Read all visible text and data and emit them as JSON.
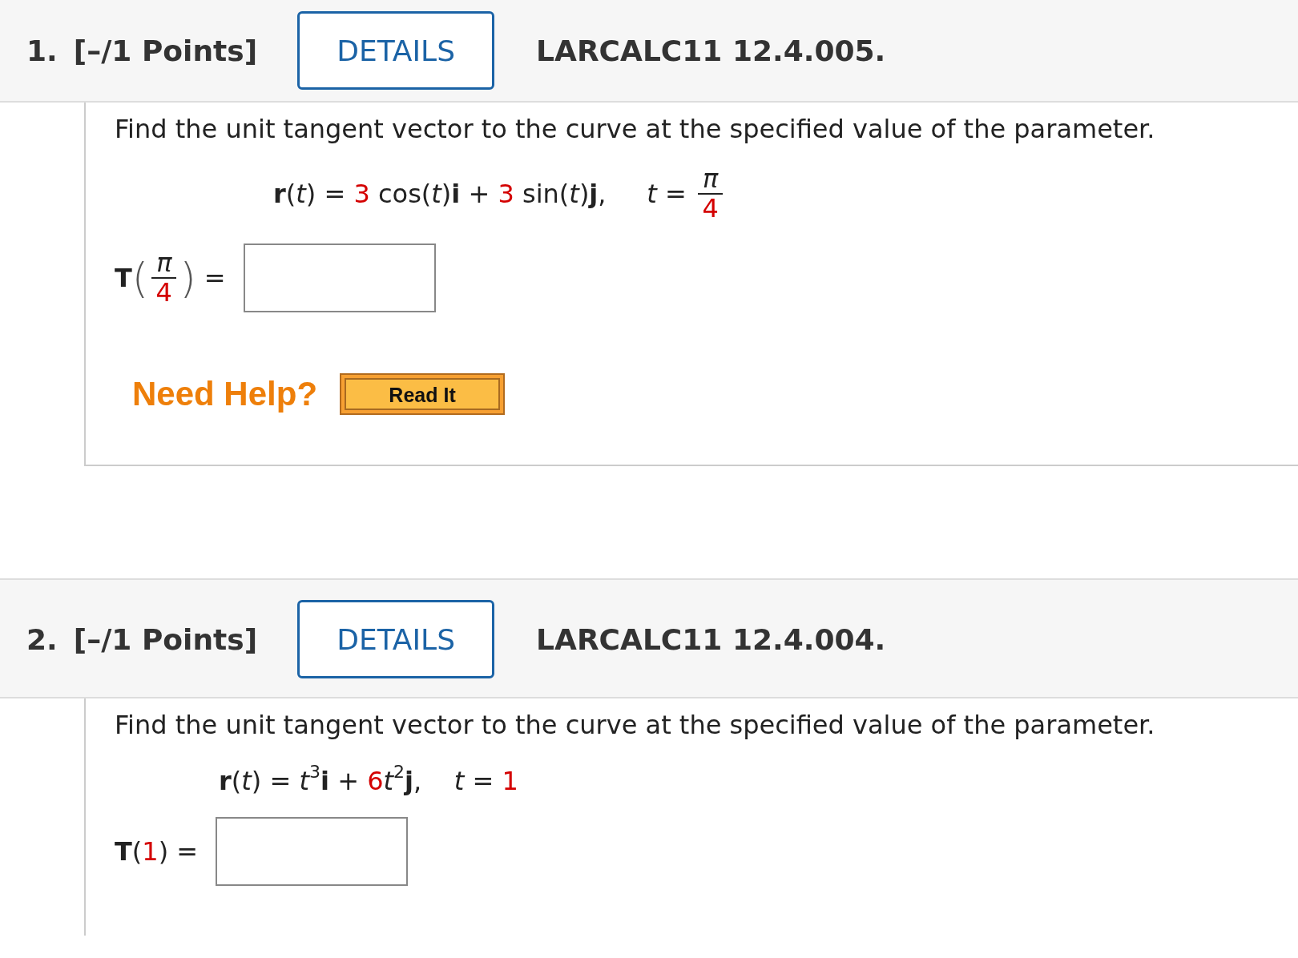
{
  "questions": [
    {
      "number": "1.",
      "points": "[–/1 Points]",
      "details_button": "DETAILS",
      "problem_id": "LARCALC11 12.4.005.",
      "prompt": "Find the unit tangent vector to the curve at the specified value of the parameter.",
      "formula": [
        {
          "kind": "bold",
          "text": "r"
        },
        {
          "kind": "plain",
          "text": "("
        },
        {
          "kind": "italic",
          "text": "t"
        },
        {
          "kind": "plain",
          "text": ") = "
        },
        {
          "kind": "red",
          "text": "3"
        },
        {
          "kind": "plain",
          "text": " cos("
        },
        {
          "kind": "italic",
          "text": "t"
        },
        {
          "kind": "plain",
          "text": ")"
        },
        {
          "kind": "bold",
          "text": "i"
        },
        {
          "kind": "plain",
          "text": " + "
        },
        {
          "kind": "red",
          "text": "3"
        },
        {
          "kind": "plain",
          "text": " sin("
        },
        {
          "kind": "italic",
          "text": "t"
        },
        {
          "kind": "plain",
          "text": ")"
        },
        {
          "kind": "bold",
          "text": "j"
        },
        {
          "kind": "plain",
          "text": ",     "
        },
        {
          "kind": "italic",
          "text": "t"
        },
        {
          "kind": "plain",
          "text": " = "
        },
        {
          "kind": "frac",
          "num": "π",
          "den": "4"
        }
      ],
      "answer_label": [
        {
          "kind": "bold",
          "text": "T"
        },
        {
          "kind": "bigparen",
          "text": "("
        },
        {
          "kind": "frac",
          "num": "π",
          "den": "4"
        },
        {
          "kind": "bigparen",
          "text": ")"
        },
        {
          "kind": "plain",
          "text": " = "
        }
      ],
      "need_help": {
        "label": "Need Help?",
        "button": "Read It"
      }
    },
    {
      "number": "2.",
      "points": "[–/1 Points]",
      "details_button": "DETAILS",
      "problem_id": "LARCALC11 12.4.004.",
      "prompt": "Find the unit tangent vector to the curve at the specified value of the parameter.",
      "formula": [
        {
          "kind": "bold",
          "text": "r"
        },
        {
          "kind": "plain",
          "text": "("
        },
        {
          "kind": "italic",
          "text": "t"
        },
        {
          "kind": "plain",
          "text": ") = "
        },
        {
          "kind": "italic",
          "text": "t"
        },
        {
          "kind": "sup",
          "text": "3"
        },
        {
          "kind": "bold",
          "text": "i"
        },
        {
          "kind": "plain",
          "text": " + "
        },
        {
          "kind": "red",
          "text": "6"
        },
        {
          "kind": "italic",
          "text": "t"
        },
        {
          "kind": "sup",
          "text": "2"
        },
        {
          "kind": "bold",
          "text": "j"
        },
        {
          "kind": "plain",
          "text": ",    "
        },
        {
          "kind": "italic",
          "text": "t"
        },
        {
          "kind": "plain",
          "text": " = "
        },
        {
          "kind": "red",
          "text": "1"
        }
      ],
      "answer_label": [
        {
          "kind": "bold",
          "text": "T"
        },
        {
          "kind": "plain",
          "text": "("
        },
        {
          "kind": "red",
          "text": "1"
        },
        {
          "kind": "plain",
          "text": ") = "
        }
      ]
    }
  ]
}
